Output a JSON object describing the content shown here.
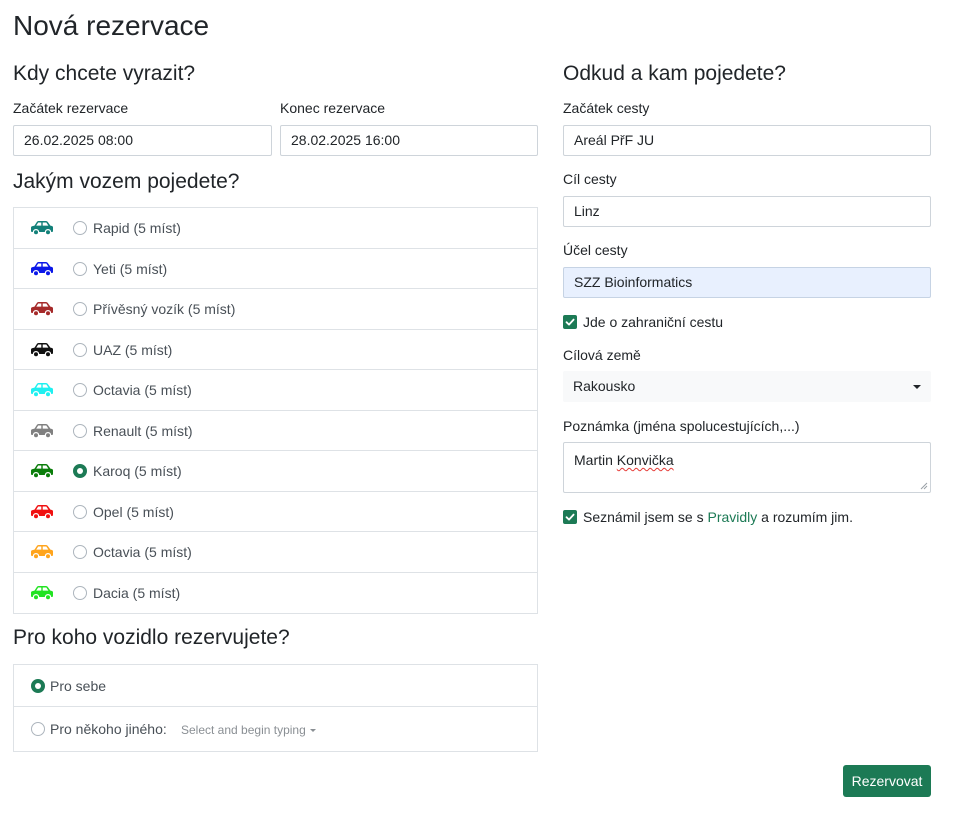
{
  "page_title": "Nová rezervace",
  "when": {
    "heading": "Kdy chcete vyrazit?",
    "start_label": "Začátek rezervace",
    "start_value": "26.02.2025 08:00",
    "end_label": "Konec rezervace",
    "end_value": "28.02.2025 16:00"
  },
  "vehicle": {
    "heading": "Jakým vozem pojedete?",
    "cars": [
      {
        "label": "Rapid (5 míst)",
        "color": "#128079",
        "selected": false
      },
      {
        "label": "Yeti (5 míst)",
        "color": "#0b17e8",
        "selected": false
      },
      {
        "label": "Přívěsný vozík (5 míst)",
        "color": "#a52a2a",
        "selected": false
      },
      {
        "label": "UAZ (5 míst)",
        "color": "#111111",
        "selected": false
      },
      {
        "label": "Octavia (5 míst)",
        "color": "#1ff0f0",
        "selected": false
      },
      {
        "label": "Renault (5 míst)",
        "color": "#808080",
        "selected": false
      },
      {
        "label": "Karoq (5 míst)",
        "color": "#0a7d0a",
        "selected": true
      },
      {
        "label": "Opel (5 míst)",
        "color": "#f01010",
        "selected": false
      },
      {
        "label": "Octavia (5 míst)",
        "color": "#ffa41c",
        "selected": false
      },
      {
        "label": "Dacia (5 míst)",
        "color": "#22e322",
        "selected": false
      }
    ],
    "car_icon": "car-icon"
  },
  "for_whom": {
    "heading": "Pro koho vozidlo rezervujete?",
    "self_label": "Pro sebe",
    "self_selected": true,
    "other_label": "Pro někoho jiného:",
    "other_placeholder": "Select and begin typing",
    "other_selected": false
  },
  "route": {
    "heading": "Odkud a kam pojedete?",
    "from_label": "Začátek cesty",
    "from_value": "Areál PřF JU",
    "to_label": "Cíl cesty",
    "to_value": "Linz",
    "purpose_label": "Účel cesty",
    "purpose_value": "SZZ Bioinformatics",
    "abroad_label": "Jde o zahraniční cestu",
    "abroad_checked": true,
    "country_label": "Cílová země",
    "country_value": "Rakousko",
    "note_label": "Poznámka (jména spolucestujících,...)",
    "note_value_first": "Martin",
    "note_value_second": "Konvička",
    "rules_prefix": "Seznámil jsem se s",
    "rules_link": "Pravidly",
    "rules_suffix": "a rozumím jim.",
    "rules_checked": true
  },
  "submit_label": "Rezervovat",
  "colors": {
    "accent": "#1c7a55",
    "border": "#dee2e6",
    "input_border": "#ced4da",
    "autofill_bg": "#e8f0fe"
  }
}
